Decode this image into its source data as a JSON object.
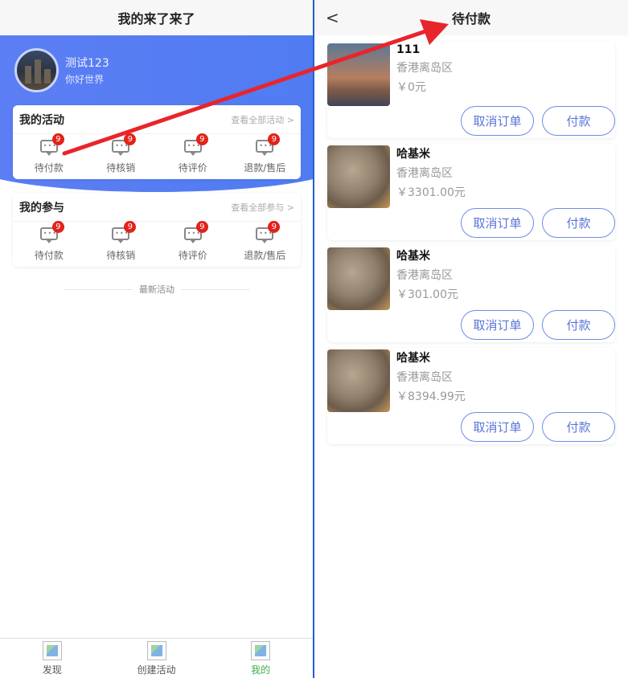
{
  "left": {
    "header_title": "我的来了来了",
    "user": {
      "name": "测试123",
      "subtitle": "你好世界"
    },
    "activity_card": {
      "title": "我的活动",
      "more": "查看全部活动 >",
      "items": [
        {
          "label": "待付款",
          "badge": "9"
        },
        {
          "label": "待核销",
          "badge": "9"
        },
        {
          "label": "待评价",
          "badge": "9"
        },
        {
          "label": "退款/售后",
          "badge": "9"
        }
      ]
    },
    "participation_card": {
      "title": "我的参与",
      "more": "查看全部参与 >",
      "items": [
        {
          "label": "待付款",
          "badge": "9"
        },
        {
          "label": "待核销",
          "badge": "9"
        },
        {
          "label": "待评价",
          "badge": "9"
        },
        {
          "label": "退款/售后",
          "badge": "9"
        }
      ]
    },
    "divider_text": "最新活动",
    "tabs": [
      {
        "label": "发现"
      },
      {
        "label": "创建活动"
      },
      {
        "label": "我的"
      }
    ]
  },
  "right": {
    "back": "<",
    "header_title": "待付款",
    "orders": [
      {
        "name": "111",
        "area": "香港离岛区",
        "price": "￥0元",
        "cancel": "取消订单",
        "pay": "付款"
      },
      {
        "name": "哈基米",
        "area": "香港离岛区",
        "price": "￥3301.00元",
        "cancel": "取消订单",
        "pay": "付款"
      },
      {
        "name": "哈基米",
        "area": "香港离岛区",
        "price": "￥301.00元",
        "cancel": "取消订单",
        "pay": "付款"
      },
      {
        "name": "哈基米",
        "area": "香港离岛区",
        "price": "￥8394.99元",
        "cancel": "取消订单",
        "pay": "付款"
      }
    ]
  },
  "colors": {
    "accent_blue": "#5d7ef4",
    "badge_red": "#e2231a",
    "active_tab": "#3cb043",
    "arrow_red": "#e8252b"
  }
}
